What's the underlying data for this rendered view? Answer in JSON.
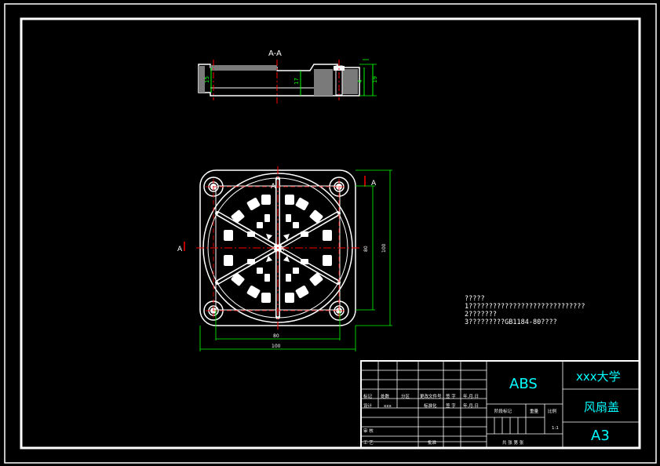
{
  "section": {
    "title": "A-A",
    "dims": [
      "15",
      "17",
      "4",
      "19"
    ]
  },
  "plan": {
    "cut_marks": [
      "A",
      "A",
      "A",
      "A"
    ],
    "dims": {
      "inner_width": "80",
      "outer_width": "100",
      "inner_height": "80",
      "outer_height": "100"
    }
  },
  "notes": {
    "lines": [
      "?????",
      "1?????????????????????????????",
      "2???????",
      "3?????????GB1184-80????"
    ]
  },
  "title_block": {
    "material": "ABS",
    "school": "xxx大学",
    "part_name": "风扇盖",
    "sheet_size": "A3",
    "scale": "1:1",
    "label_mark": "标记",
    "label_count": "处数",
    "label_zone": "分区",
    "label_change_doc": "更改文件号",
    "label_sign": "签 字",
    "label_date": "年.月.日",
    "label_design": "设计",
    "label_designer": "xxx",
    "label_standard": "标准化",
    "label_stage": "阶段标记",
    "label_weight": "重量",
    "label_scale": "比例",
    "label_review": "审 核",
    "label_process": "工 艺",
    "label_approve": "批准",
    "label_sheets": "共  张  第  张"
  },
  "colors": {
    "background": "#000000",
    "frame": "#ffffff",
    "dimension": "#00ff00",
    "centerline": "#ff0000",
    "title_text": "#00ffff"
  }
}
